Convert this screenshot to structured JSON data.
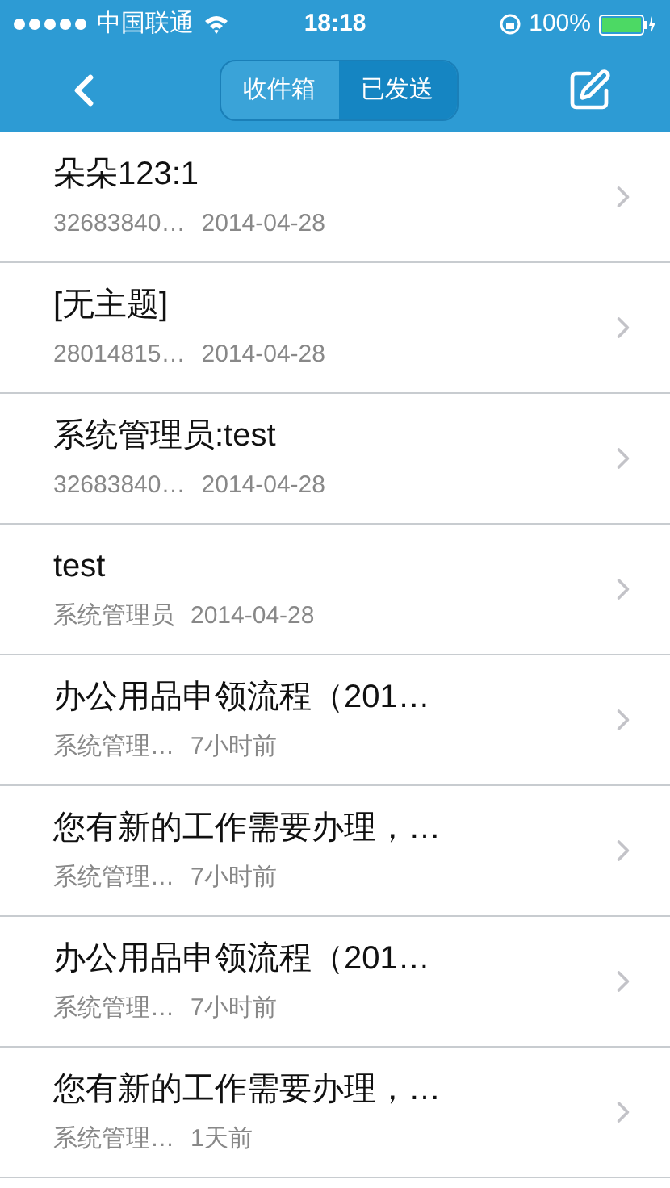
{
  "status_bar": {
    "carrier": "中国联通",
    "time": "18:18",
    "battery": "100%"
  },
  "segments": [
    {
      "label": "收件箱",
      "selected": false
    },
    {
      "label": "已发送",
      "selected": true
    }
  ],
  "messages": [
    {
      "title": "朵朵123:1",
      "sender": "32683840…",
      "time": "2014-04-28"
    },
    {
      "title": "[无主题]",
      "sender": "28014815…",
      "time": "2014-04-28"
    },
    {
      "title": "系统管理员:test",
      "sender": "32683840…",
      "time": "2014-04-28"
    },
    {
      "title": "test",
      "sender": "系统管理员",
      "time": "2014-04-28"
    },
    {
      "title": "办公用品申领流程（201…",
      "sender": "系统管理…",
      "time": "7小时前"
    },
    {
      "title": "您有新的工作需要办理，…",
      "sender": "系统管理…",
      "time": "7小时前"
    },
    {
      "title": "办公用品申领流程（201…",
      "sender": "系统管理…",
      "time": "7小时前"
    },
    {
      "title": "您有新的工作需要办理，…",
      "sender": "系统管理…",
      "time": "1天前"
    }
  ]
}
